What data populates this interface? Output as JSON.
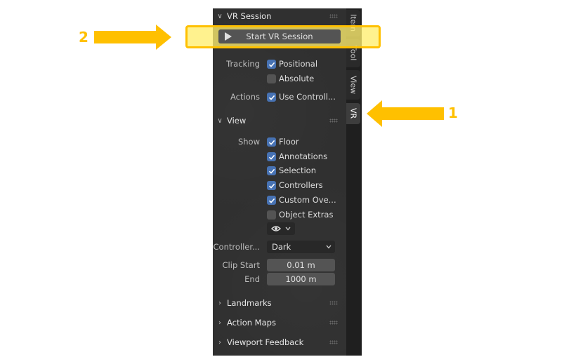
{
  "vr_session": {
    "title": "VR Session",
    "start_button": "Start VR Session",
    "tracking_label": "Tracking",
    "positional": "Positional",
    "absolute": "Absolute",
    "actions_label": "Actions",
    "use_controllers": "Use Controll..."
  },
  "view": {
    "title": "View",
    "show_label": "Show",
    "options": [
      "Floor",
      "Annotations",
      "Selection",
      "Controllers",
      "Custom Ove...",
      "Object Extras"
    ],
    "controller_label": "Controller...",
    "controller_value": "Dark",
    "clip_start_label": "Clip Start",
    "clip_start_value": "0.01 m",
    "end_label": "End",
    "end_value": "1000 m"
  },
  "collapsed_panels": [
    "Landmarks",
    "Action Maps",
    "Viewport Feedback"
  ],
  "tabs": [
    "Item",
    "Tool",
    "View",
    "VR"
  ],
  "annotations": {
    "num1": "1",
    "num2": "2"
  },
  "colors": {
    "highlight": "#ffc000",
    "checkbox_on": "#4772b3",
    "panel_bg": "#303030"
  }
}
